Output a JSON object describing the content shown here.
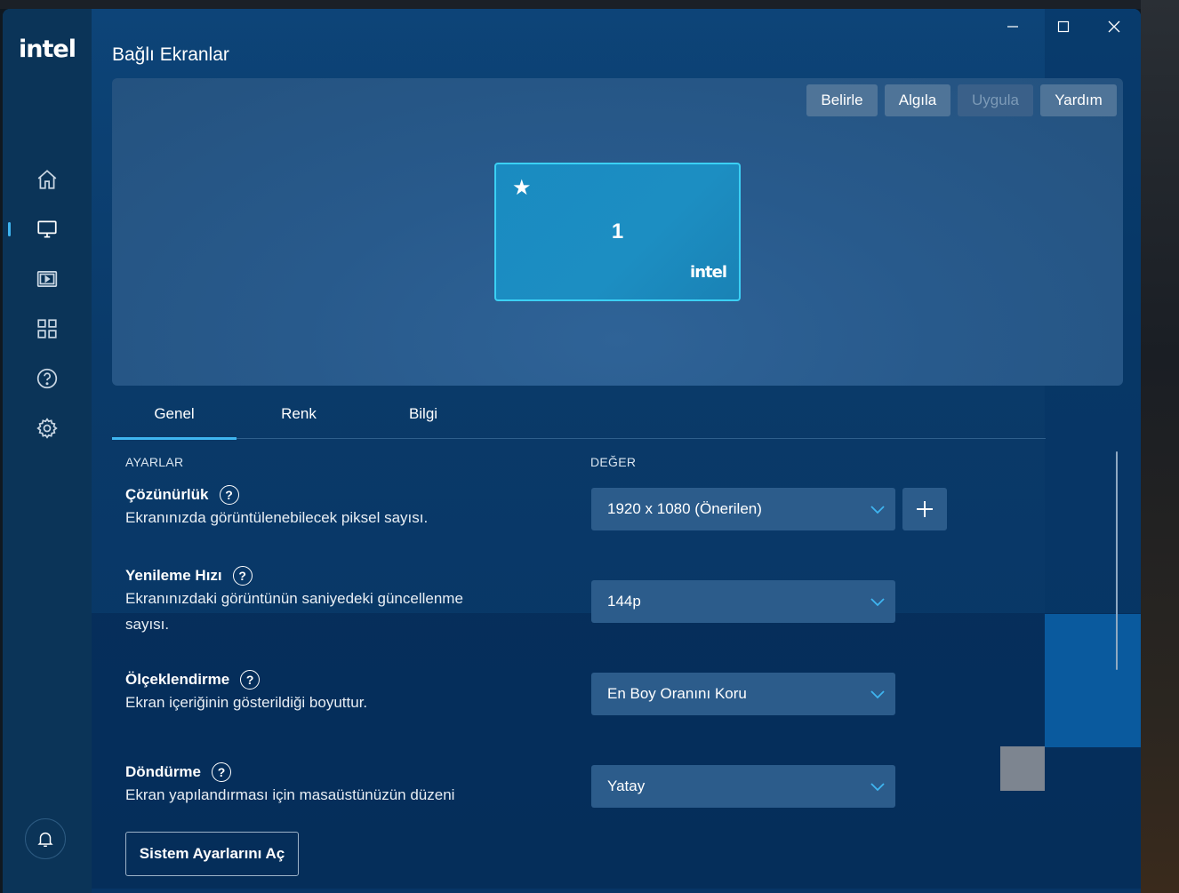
{
  "window": {
    "title": "Bağlı Ekranlar",
    "logo_text": "intel",
    "controls": {
      "minimize": "minimize-icon",
      "maximize": "maximize-icon",
      "close": "close-icon"
    }
  },
  "sidebar": {
    "items": [
      {
        "icon": "home-icon",
        "active": false
      },
      {
        "icon": "monitor-icon",
        "active": true
      },
      {
        "icon": "video-icon",
        "active": false
      },
      {
        "icon": "apps-grid-icon",
        "active": false
      },
      {
        "icon": "help-icon",
        "active": false
      },
      {
        "icon": "gear-icon",
        "active": false
      }
    ],
    "bottom_icon": "bell-icon"
  },
  "preview": {
    "buttons": [
      {
        "label": "Belirle",
        "enabled": true
      },
      {
        "label": "Algıla",
        "enabled": true
      },
      {
        "label": "Uygula",
        "enabled": false
      },
      {
        "label": "Yardım",
        "enabled": true
      }
    ],
    "monitor": {
      "number": "1",
      "logo": "intel",
      "primary_icon": "star-icon"
    }
  },
  "tabs": [
    {
      "label": "Genel",
      "active": true
    },
    {
      "label": "Renk",
      "active": false
    },
    {
      "label": "Bilgi",
      "active": false
    }
  ],
  "columns": {
    "settings": "AYARLAR",
    "value": "DEĞER"
  },
  "settings": [
    {
      "title": "Çözünürlük",
      "description": "Ekranınızda görüntülenebilecek piksel sayısı.",
      "value": "1920 x 1080 (Önerilen)"
    },
    {
      "title": "Yenileme Hızı",
      "description": "Ekranınızdaki görüntünün saniyedeki güncellenme sayısı.",
      "value": "144p"
    },
    {
      "title": "Ölçeklendirme",
      "description": "Ekran içeriğinin gösterildiği boyuttur.",
      "value": "En Boy Oranını Koru"
    },
    {
      "title": "Döndürme",
      "description": "Ekran yapılandırması için masaüstünüzün düzeni",
      "value": "Yatay"
    }
  ],
  "system_settings_button": "Sistem Ayarlarını Aç",
  "colors": {
    "accent": "#3fb5f0",
    "background": "#0c3f6e",
    "sidebar": "#0b3458",
    "field": "#2c5c8b",
    "monitor_border": "#3bd0f4"
  }
}
